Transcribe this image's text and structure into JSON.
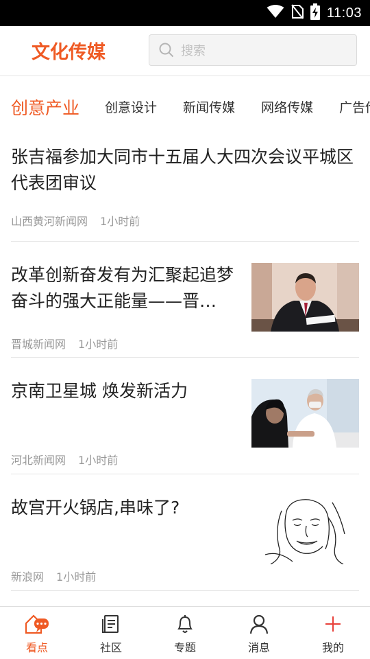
{
  "status": {
    "time": "11:03"
  },
  "header": {
    "logo": "文化传媒",
    "search_placeholder": "搜索"
  },
  "tabs": [
    "创意产业",
    "创意设计",
    "新闻传媒",
    "网络传媒",
    "广告传"
  ],
  "articles": [
    {
      "title": "张吉福参加大同市十五届人大四次会议平城区代表团审议",
      "source": "山西黄河新闻网",
      "time": "1小时前"
    },
    {
      "title": "改革创新奋发有为汇聚起追梦奋斗的强大正能量——晋…",
      "source": "晋城新闻网",
      "time": "1小时前"
    },
    {
      "title": "京南卫星城 焕发新活力",
      "source": "河北新闻网",
      "time": "1小时前"
    },
    {
      "title": "故宫开火锅店,串味了?",
      "source": "新浪网",
      "time": "1小时前"
    }
  ],
  "nav": [
    {
      "label": "看点",
      "icon": "chat-house-icon"
    },
    {
      "label": "社区",
      "icon": "document-icon"
    },
    {
      "label": "专题",
      "icon": "bell-icon"
    },
    {
      "label": "消息",
      "icon": "person-icon"
    },
    {
      "label": "我的",
      "icon": "plus-icon"
    }
  ],
  "colors": {
    "accent": "#ef5a24",
    "meta_text": "#999999"
  }
}
